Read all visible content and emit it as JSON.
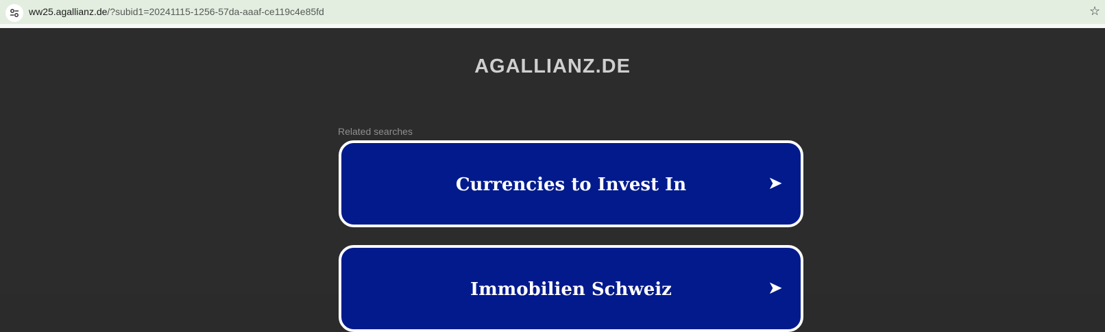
{
  "browser": {
    "url_domain": "ww25.agallianz.de",
    "url_path": "/?subid1=20241115-1256-57da-aaaf-ce119c4e85fd",
    "site_info_icon": "tune-icon",
    "bookmark_icon": "star-icon",
    "bookmark_glyph": "☆"
  },
  "page": {
    "title": "AGALLIANZ.DE",
    "related_label": "Related searches",
    "links": [
      {
        "label": "Currencies to Invest In",
        "arrow": "➤"
      },
      {
        "label": "Immobilien Schweiz",
        "arrow": "➤"
      }
    ]
  },
  "colors": {
    "page_background": "#2c2c2c",
    "button_background": "#021a8c",
    "button_border": "#ffffff",
    "title_color": "#cfcfcf",
    "address_bar": "#e3eee0"
  }
}
